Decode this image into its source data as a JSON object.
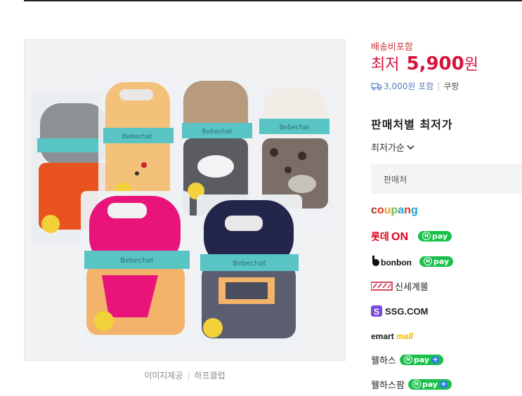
{
  "image": {
    "caption_label": "이미지제공",
    "caption_source": "하프클럽",
    "product_tag": "Bebechat"
  },
  "price": {
    "shipping_included": "배송비포함",
    "lowest_label": "최저",
    "amount": "5,900",
    "unit": "원",
    "shipping_fee": "3,000원 포함",
    "store": "쿠팡"
  },
  "sellers_section": {
    "title": "판매처별 최저가",
    "sort_label": "최저가순",
    "header": "판매처",
    "sellers": [
      {
        "name": "coupang"
      },
      {
        "name": "롯데ON",
        "npay": "pay"
      },
      {
        "name": "bonbon",
        "npay": "pay"
      },
      {
        "name": "신세계몰"
      },
      {
        "name": "SSG.COM"
      },
      {
        "name": "emart mall"
      },
      {
        "name": "웰하스",
        "npay": "pay"
      },
      {
        "name": "웰하스팜",
        "npay": "pay"
      }
    ]
  },
  "colors": {
    "price_red": "#d6133c",
    "link_blue": "#5b7fbf",
    "npay_green": "#19c14b"
  }
}
